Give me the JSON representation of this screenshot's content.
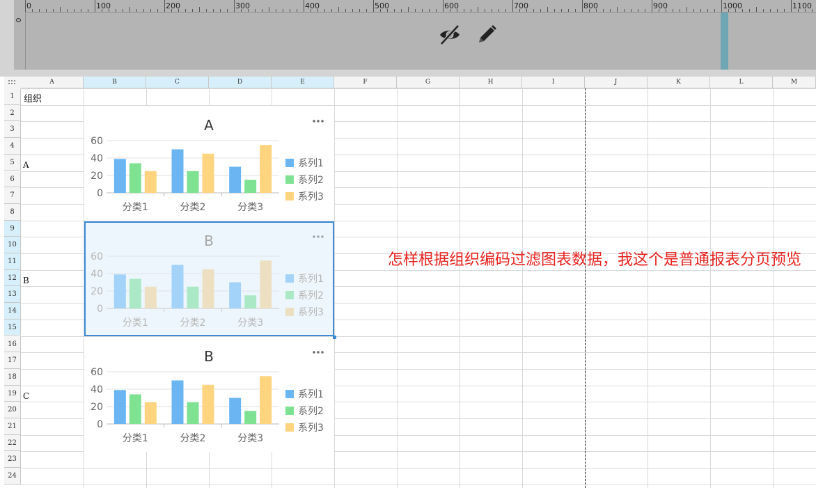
{
  "ruler": {
    "labels": [
      "0",
      "100",
      "200",
      "300",
      "400",
      "500",
      "600",
      "700",
      "800",
      "900",
      "1000",
      "1100"
    ],
    "vertical_label": "0"
  },
  "toolbar": {
    "hide_icon": "eye-slash-icon",
    "edit_icon": "pencil-icon"
  },
  "sheet": {
    "columns": [
      "A",
      "B",
      "C",
      "D",
      "E",
      "F",
      "G",
      "H",
      "I",
      "J",
      "K",
      "L",
      "M"
    ],
    "selected_columns": [
      "B",
      "C",
      "D",
      "E"
    ],
    "rows": [
      "1",
      "2",
      "3",
      "4",
      "5",
      "6",
      "7",
      "8",
      "9",
      "10",
      "11",
      "12",
      "13",
      "14",
      "15",
      "16",
      "17",
      "18",
      "19",
      "20",
      "21",
      "22",
      "23",
      "24"
    ],
    "selected_rows": [
      "9",
      "10",
      "11",
      "12",
      "13",
      "14",
      "15"
    ],
    "cells": {
      "A1": "组织",
      "A5": "A",
      "A12": "B",
      "A19": "C"
    }
  },
  "chart_data": [
    {
      "type": "bar",
      "title": "A",
      "categories": [
        "分类1",
        "分类2",
        "分类3"
      ],
      "series": [
        {
          "name": "系列1",
          "values": [
            39,
            50,
            30
          ]
        },
        {
          "name": "系列2",
          "values": [
            34,
            25,
            15
          ]
        },
        {
          "name": "系列3",
          "values": [
            25,
            45,
            55
          ]
        }
      ],
      "ylim": [
        0,
        60
      ],
      "yticks": [
        "0",
        "20",
        "40",
        "60"
      ],
      "grid": true,
      "legend": "right",
      "colors": [
        "#6bb6f2",
        "#7fe192",
        "#fed47f"
      ],
      "menu_icon": "more-horizontal-icon"
    },
    {
      "type": "bar",
      "title": "B",
      "categories": [
        "分类1",
        "分类2",
        "分类3"
      ],
      "series": [
        {
          "name": "系列1",
          "values": [
            39,
            50,
            30
          ]
        },
        {
          "name": "系列2",
          "values": [
            34,
            25,
            15
          ]
        },
        {
          "name": "系列3",
          "values": [
            25,
            45,
            55
          ]
        }
      ],
      "ylim": [
        0,
        60
      ],
      "yticks": [
        "0",
        "20",
        "40",
        "60"
      ],
      "grid": true,
      "legend": "right",
      "colors": [
        "#a3d3f8",
        "#abe9c6",
        "#ede0c2"
      ],
      "selected": true,
      "menu_icon": "more-horizontal-icon"
    },
    {
      "type": "bar",
      "title": "B",
      "categories": [
        "分类1",
        "分类2",
        "分类3"
      ],
      "series": [
        {
          "name": "系列1",
          "values": [
            39,
            50,
            30
          ]
        },
        {
          "name": "系列2",
          "values": [
            34,
            25,
            15
          ]
        },
        {
          "name": "系列3",
          "values": [
            25,
            45,
            55
          ]
        }
      ],
      "ylim": [
        0,
        60
      ],
      "yticks": [
        "0",
        "20",
        "40",
        "60"
      ],
      "grid": true,
      "legend": "right",
      "colors": [
        "#6bb6f2",
        "#7fe192",
        "#fed47f"
      ],
      "menu_icon": "more-horizontal-icon"
    }
  ],
  "annotation": "怎样根据组织编码过滤图表数据，我这个是普通报表分页预览"
}
